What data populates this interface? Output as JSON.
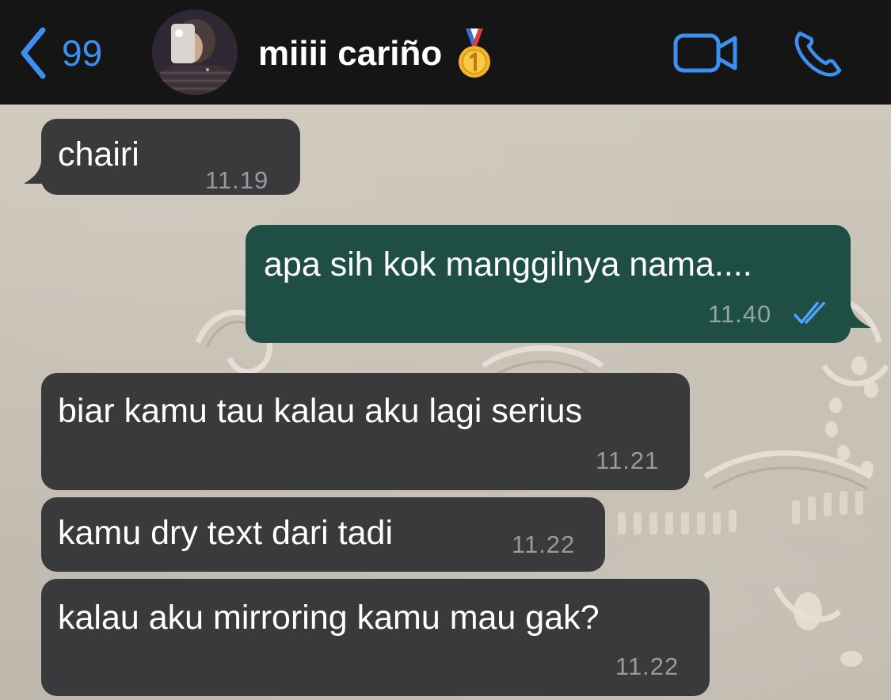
{
  "header": {
    "back_count": "99",
    "contact_name": "miiii cariño",
    "name_emoji_icon": "first-place-medal-icon",
    "accent_color": "#3d8ff0"
  },
  "messages": [
    {
      "direction": "incoming",
      "text": "chairi",
      "time": "11.19"
    },
    {
      "direction": "outgoing",
      "text": "apa sih kok manggilnya nama....",
      "time": "11.40",
      "status": "read-double-check-icon"
    },
    {
      "direction": "incoming",
      "text": "biar kamu tau kalau aku lagi serius",
      "time": "11.21"
    },
    {
      "direction": "incoming",
      "text": "kamu dry text dari tadi",
      "time": "11.22"
    },
    {
      "direction": "incoming",
      "text": "kalau aku mirroring kamu mau gak?",
      "time": "11.22"
    }
  ],
  "colors": {
    "incoming_bubble": "#3a3a3c",
    "outgoing_bubble": "#1f4f44",
    "read_ticks": "#4da3ff"
  }
}
